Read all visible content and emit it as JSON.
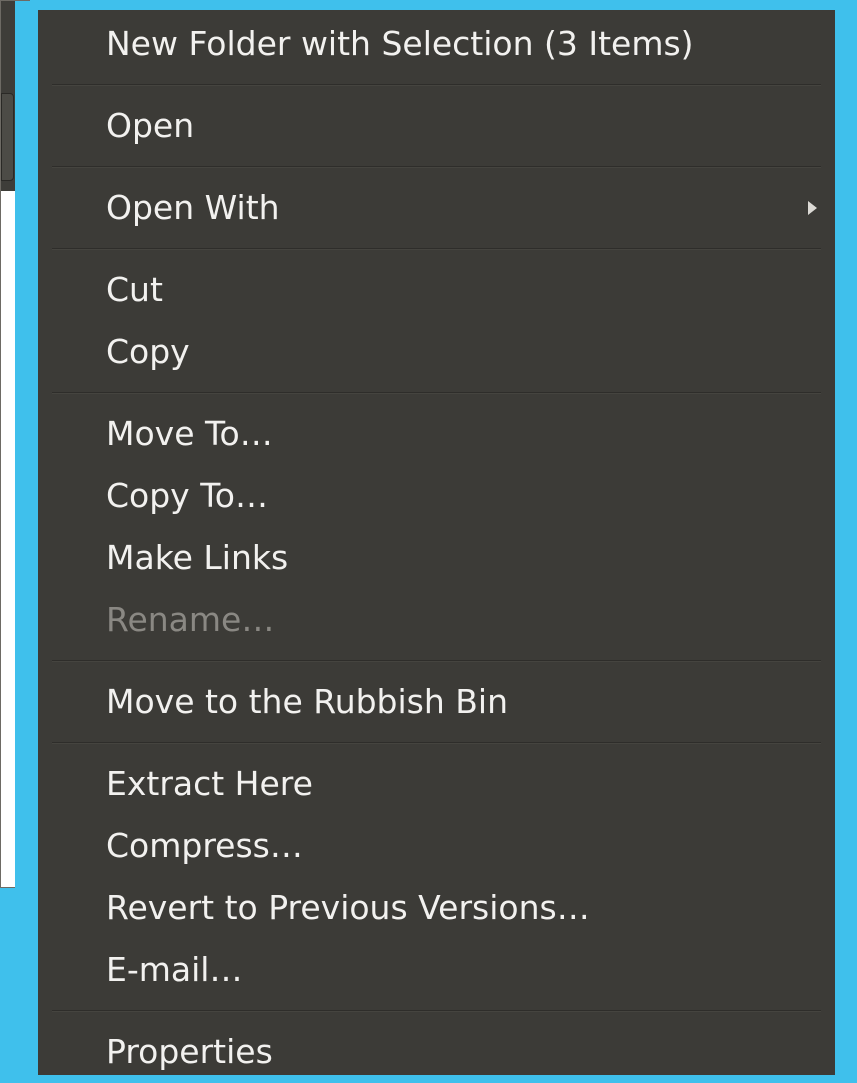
{
  "menu": {
    "groups": [
      [
        {
          "label": "New Folder with Selection (3 Items)",
          "enabled": true
        }
      ],
      [
        {
          "label": "Open",
          "enabled": true
        }
      ],
      [
        {
          "label": "Open With",
          "enabled": true,
          "submenu": true
        }
      ],
      [
        {
          "label": "Cut",
          "enabled": true
        },
        {
          "label": "Copy",
          "enabled": true
        }
      ],
      [
        {
          "label": "Move To…",
          "enabled": true
        },
        {
          "label": "Copy To…",
          "enabled": true
        },
        {
          "label": "Make Links",
          "enabled": true
        },
        {
          "label": "Rename…",
          "enabled": false
        }
      ],
      [
        {
          "label": "Move to the Rubbish Bin",
          "enabled": true
        }
      ],
      [
        {
          "label": "Extract Here",
          "enabled": true
        },
        {
          "label": "Compress…",
          "enabled": true
        },
        {
          "label": "Revert to Previous Versions…",
          "enabled": true
        },
        {
          "label": "E-mail…",
          "enabled": true
        }
      ],
      [
        {
          "label": "Properties",
          "enabled": true
        }
      ]
    ]
  },
  "colors": {
    "desktop": "#3fc0ec",
    "menu_bg": "#3c3b37",
    "text": "#f2f1ef",
    "disabled_text": "#8a8883"
  }
}
